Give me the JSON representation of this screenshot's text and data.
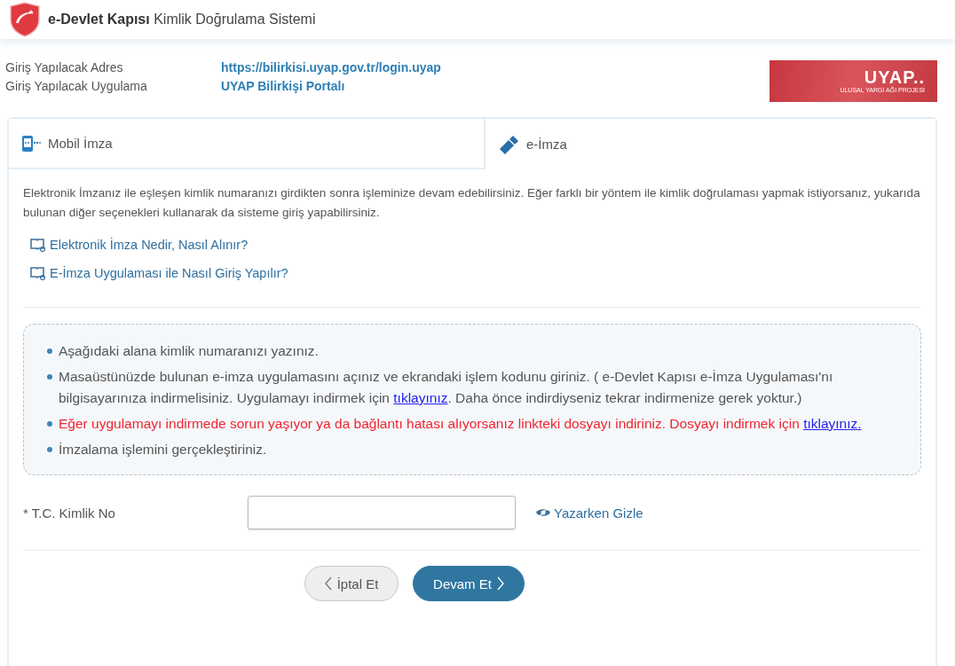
{
  "header": {
    "brand": "e-Devlet Kapısı",
    "title": "Kimlik Doğrulama Sistemi"
  },
  "login_info": [
    {
      "label": "Giriş Yapılacak Adres",
      "value": "https://bilirkisi.uyap.gov.tr/login.uyap"
    },
    {
      "label": "Giriş Yapılacak Uygulama",
      "value": "UYAP Bilirkişi Portalı"
    }
  ],
  "partner_logo": {
    "name": "UYAP..",
    "subtitle": "ULUSAL YARGI AĞI PROJESİ"
  },
  "tabs": [
    {
      "label": "Mobil İmza",
      "kind": "mobile",
      "selected": false
    },
    {
      "label": "e-İmza",
      "kind": "esign",
      "selected": true
    }
  ],
  "description": "Elektronik İmzanız ile eşleşen kimlik numaranızı girdikten sonra işleminize devam edebilirsiniz. Eğer farklı bir yöntem ile kimlik doğrulaması yapmak istiyorsanız, yukarıda bulunan diğer seçenekleri kullanarak da sisteme giriş yapabilirsiniz.",
  "help_links": [
    "Elektronik İmza Nedir, Nasıl Alınır?",
    "E-İmza Uygulaması ile Nasıl Giriş Yapılır?"
  ],
  "instructions": [
    {
      "kind": "normal",
      "parts": [
        {
          "text": "Aşağıdaki alana kimlik numaranızı yazınız."
        }
      ]
    },
    {
      "kind": "normal",
      "parts": [
        {
          "text": "Masaüstünüzde bulunan e-imza uygulamasını açınız ve ekrandaki işlem kodunu giriniz. ( e-Devlet Kapısı e-İmza Uygulaması'nı bilgisayarınıza indirmelisiniz. Uygulamayı indirmek için "
        },
        {
          "link": "tıklayınız"
        },
        {
          "text": ". Daha önce indirdiyseniz tekrar indirmenize gerek yoktur.)"
        }
      ]
    },
    {
      "kind": "warning",
      "parts": [
        {
          "text": "Eğer uygulamayı indirmede sorun yaşıyor ya da bağlantı hatası alıyorsanız linkteki dosyayı indiriniz. Dosyayı indirmek için "
        },
        {
          "link": "tıklayınız."
        }
      ]
    },
    {
      "kind": "normal",
      "parts": [
        {
          "text": "İmzalama işlemini gerçekleştiriniz."
        }
      ]
    }
  ],
  "id_field": {
    "label": "* T.C. Kimlik No",
    "toggle": "Yazarken Gizle"
  },
  "buttons": [
    {
      "label": "İptal Et",
      "kind": "cancel"
    },
    {
      "label": "Devam Et",
      "kind": "primary"
    }
  ]
}
